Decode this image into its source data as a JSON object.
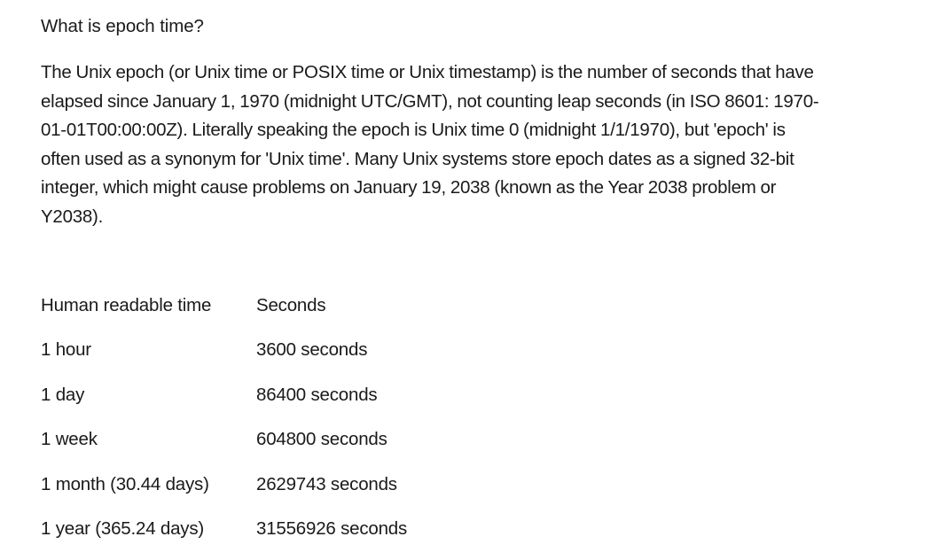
{
  "document": {
    "title": "What is epoch time?",
    "paragraph": "The Unix epoch (or Unix time or POSIX time or Unix timestamp) is the number of seconds that have elapsed since January 1, 1970 (midnight UTC/GMT), not counting leap seconds (in ISO 8601: 1970-01-01T00:00:00Z). Literally speaking the epoch is Unix time 0 (midnight 1/1/1970), but 'epoch' is often used as a synonym for 'Unix time'. Many Unix systems store epoch dates as a signed 32-bit integer, which might cause problems on January 19, 2038 (known as the Year 2038 problem or Y2038).",
    "paragraph_lines": [
      "The Unix epoch (or Unix time or POSIX time or Unix timestamp) is the number of seconds that have",
      "elapsed since January 1, 1970 (midnight UTC/GMT), not counting leap seconds (in ISO 8601: 1970-",
      "01-01T00:00:00Z). Literally speaking the epoch is Unix time 0 (midnight 1/1/1970), but 'epoch' is",
      "often used as a synonym for 'Unix time'. Many Unix systems store epoch dates as a signed 32-bit",
      "integer, which might cause problems on January 19, 2038 (known as the Year 2038 problem or",
      "Y2038)."
    ],
    "table": {
      "headers": [
        "Human readable time",
        "Seconds"
      ],
      "rows": [
        [
          "1 hour",
          "3600 seconds"
        ],
        [
          "1 day",
          "86400 seconds"
        ],
        [
          "1 week",
          "604800 seconds"
        ],
        [
          "1 month (30.44 days)",
          "2629743 seconds"
        ],
        [
          "1 year (365.24 days)",
          "31556926 seconds"
        ]
      ]
    }
  }
}
